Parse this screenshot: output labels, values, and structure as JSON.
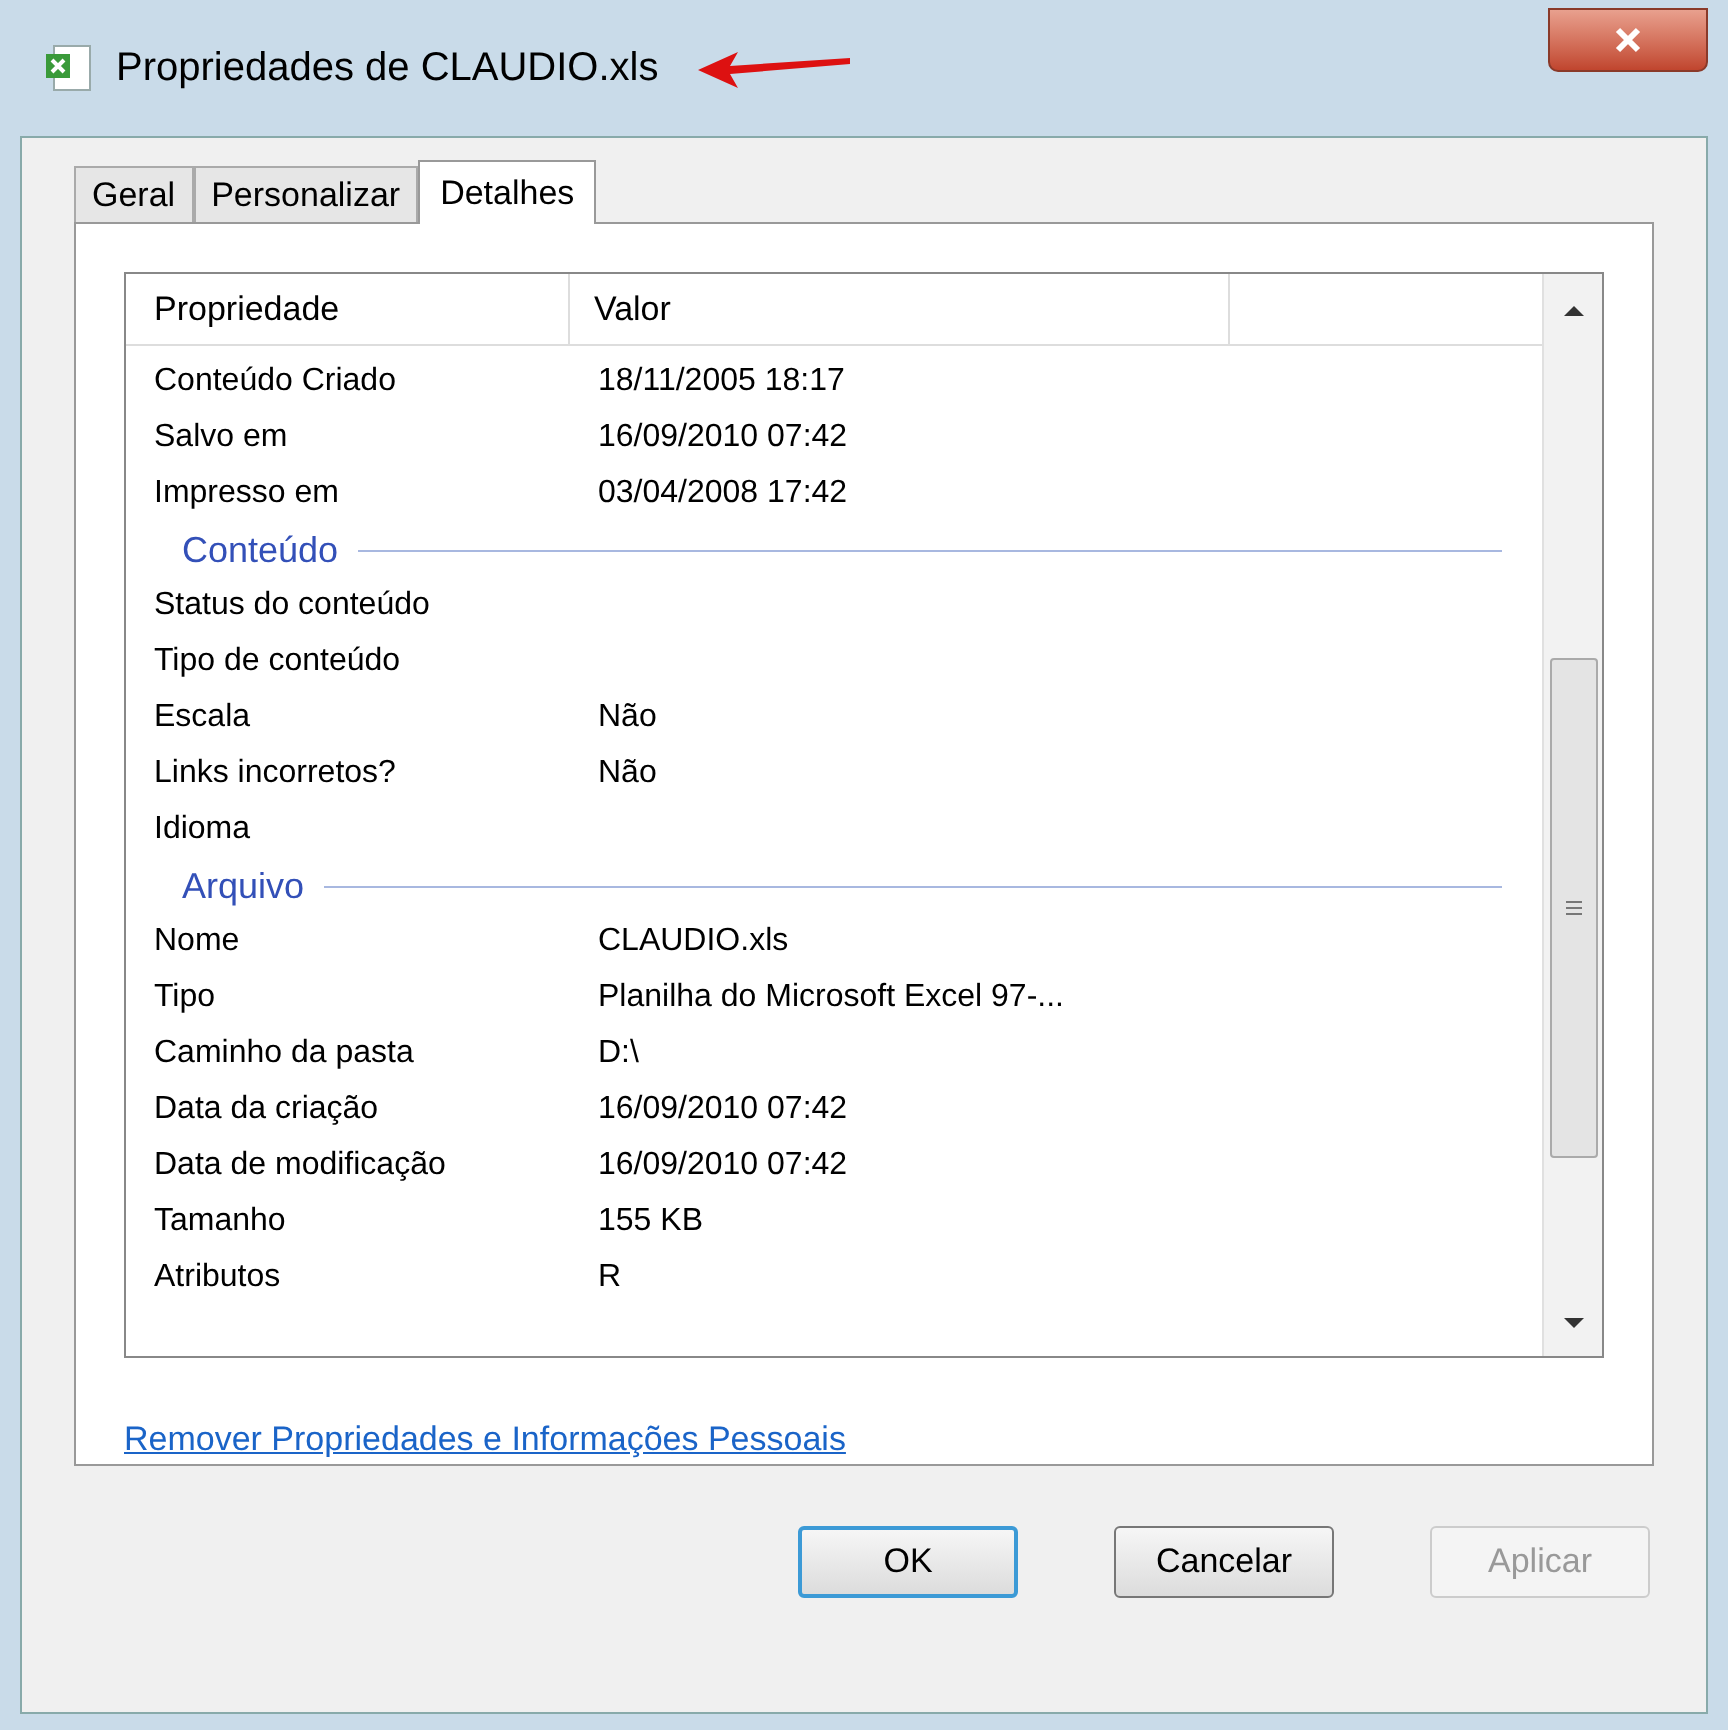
{
  "window": {
    "title": "Propriedades de CLAUDIO.xls"
  },
  "tabs": [
    {
      "label": "Geral",
      "selected": false
    },
    {
      "label": "Personalizar",
      "selected": false
    },
    {
      "label": "Detalhes",
      "selected": true
    }
  ],
  "table": {
    "columns": [
      "Propriedade",
      "Valor"
    ],
    "rows": [
      {
        "kind": "row",
        "property": "Conteúdo Criado",
        "value": "18/11/2005 18:17"
      },
      {
        "kind": "row",
        "property": "Salvo em",
        "value": "16/09/2010 07:42"
      },
      {
        "kind": "row",
        "property": "Impresso em",
        "value": "03/04/2008 17:42"
      },
      {
        "kind": "section",
        "property": "Conteúdo"
      },
      {
        "kind": "row",
        "property": "Status do conteúdo"
      },
      {
        "kind": "row",
        "property": "Tipo de conteúdo"
      },
      {
        "kind": "row",
        "property": "Escala",
        "value": "Não"
      },
      {
        "kind": "row",
        "property": "Links incorretos?",
        "value": "Não"
      },
      {
        "kind": "row",
        "property": "Idioma"
      },
      {
        "kind": "section",
        "property": "Arquivo"
      },
      {
        "kind": "row",
        "property": "Nome",
        "value": "CLAUDIO.xls"
      },
      {
        "kind": "row",
        "property": "Tipo",
        "value": "Planilha do Microsoft Excel 97-..."
      },
      {
        "kind": "row",
        "property": "Caminho da pasta",
        "value": "D:\\"
      },
      {
        "kind": "row",
        "property": "Data da criação",
        "value": "16/09/2010 07:42"
      },
      {
        "kind": "row",
        "property": "Data de modificação",
        "value": "16/09/2010 07:42"
      },
      {
        "kind": "row",
        "property": "Tamanho",
        "value": "155 KB"
      },
      {
        "kind": "row",
        "property": "Atributos",
        "value": "R"
      }
    ]
  },
  "link": "Remover Propriedades e Informações Pessoais",
  "buttons": [
    {
      "label": "OK",
      "default": true,
      "disabled": false
    },
    {
      "label": "Cancelar",
      "default": false,
      "disabled": false
    },
    {
      "label": "Aplicar",
      "default": false,
      "disabled": true
    }
  ]
}
